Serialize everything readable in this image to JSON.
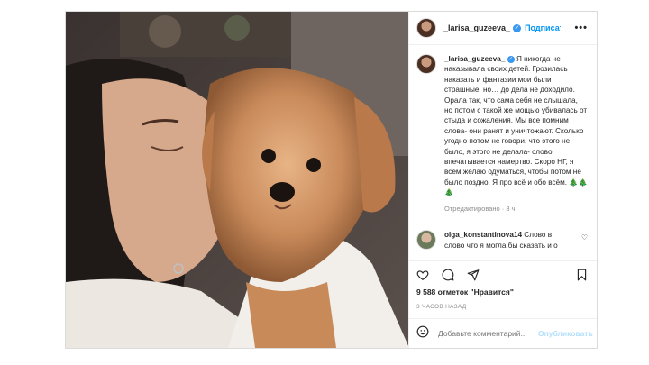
{
  "post": {
    "author": "_larisa_guzeeva_",
    "follow_label": "Подписаться",
    "more_label": "•••",
    "caption_author": "_larisa_guzeeva_",
    "caption_text": "Я никогда не наказывала своих детей. Грозилась наказать и фантазии мои были страшные, но… до дела не доходило. Орала так, что сама себя не слышала, но потом с такой же мощью убивалась от стыда и сожаления. Мы все помним слова- они ранят и уничтожают. Сколько угодно потом не говори, что этого не было, я этого не делала- слово впечатывается намертво. Скоро НГ, я всем желаю одуматься, чтобы потом не было поздно. Я про всё и обо всём. 🎄🎄🎄",
    "caption_meta": "Отредактировано · 3 ч.",
    "comment": {
      "author": "olga_konstantinova14",
      "text": "Слово в слово что я могла бы сказать и о"
    },
    "likes": "9 588 отметок \"Нравится\"",
    "time_ago": "3 ЧАСОВ НАЗАД",
    "add_comment_placeholder": "Добавьте комментарий...",
    "publish_label": "Опубликовать"
  },
  "icons": {
    "verified": "verified-badge-icon",
    "like": "heart-icon",
    "comment": "comment-icon",
    "share": "send-icon",
    "save": "bookmark-icon",
    "emoji": "emoji-icon"
  },
  "colors": {
    "accent": "#0095f6",
    "verified": "#3897f0",
    "muted": "#8e8e8e",
    "border": "#dbdbdb"
  }
}
